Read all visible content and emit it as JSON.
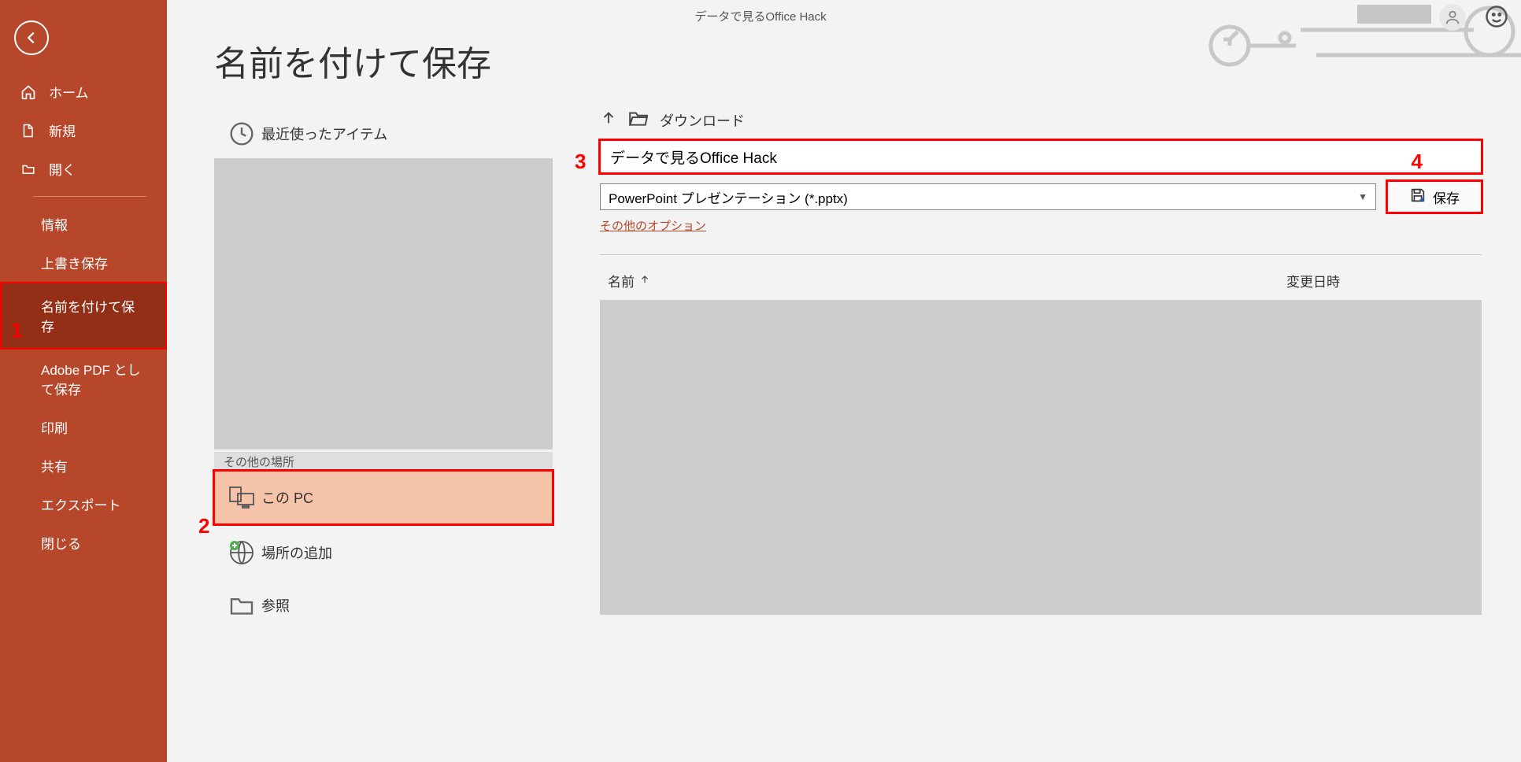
{
  "titlebar": {
    "doc_title": "データで見るOffice Hack"
  },
  "sidebar": {
    "home": "ホーム",
    "new": "新規",
    "open": "開く",
    "info": "情報",
    "save": "上書き保存",
    "saveas": "名前を付けて保存",
    "adobe": "Adobe PDF として保存",
    "print": "印刷",
    "share": "共有",
    "export": "エクスポート",
    "close": "閉じる"
  },
  "page": {
    "title": "名前を付けて保存"
  },
  "locations": {
    "recent": "最近使ったアイテム",
    "other_header": "その他の場所",
    "this_pc": "この PC",
    "add_place": "場所の追加",
    "browse": "参照"
  },
  "save": {
    "breadcrumb": "ダウンロード",
    "filename": "データで見るOffice Hack",
    "filetype": "PowerPoint プレゼンテーション (*.pptx)",
    "other_options": "その他のオプション",
    "save_btn": "保存",
    "col_name": "名前",
    "col_date": "変更日時"
  },
  "callouts": {
    "n1": "1",
    "n2": "2",
    "n3": "3",
    "n4": "4"
  }
}
